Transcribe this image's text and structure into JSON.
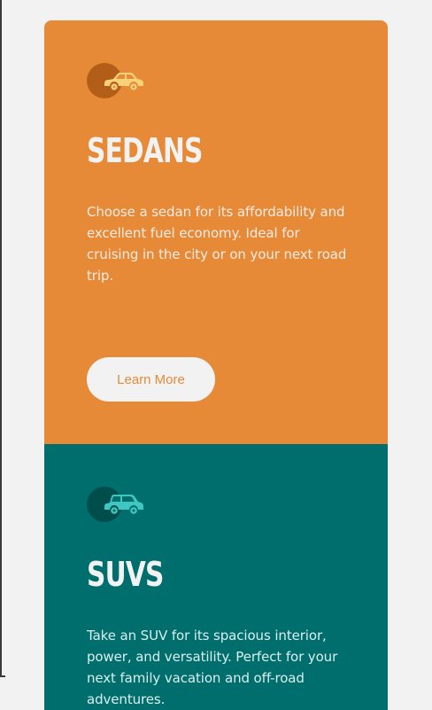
{
  "cards": [
    {
      "title": "SEDANS",
      "description": "Choose a sedan for its affordability and excellent fuel economy. Ideal for cruising in the city or on your next road trip.",
      "button_label": "Learn More",
      "icon": "sedan-car-icon",
      "color": "#e68a38"
    },
    {
      "title": "SUVS",
      "description": "Take an SUV for its spacious interior, power, and versatility. Perfect for your next family vacation and off-road adventures.",
      "icon": "suv-car-icon",
      "color": "#006e6c"
    }
  ]
}
